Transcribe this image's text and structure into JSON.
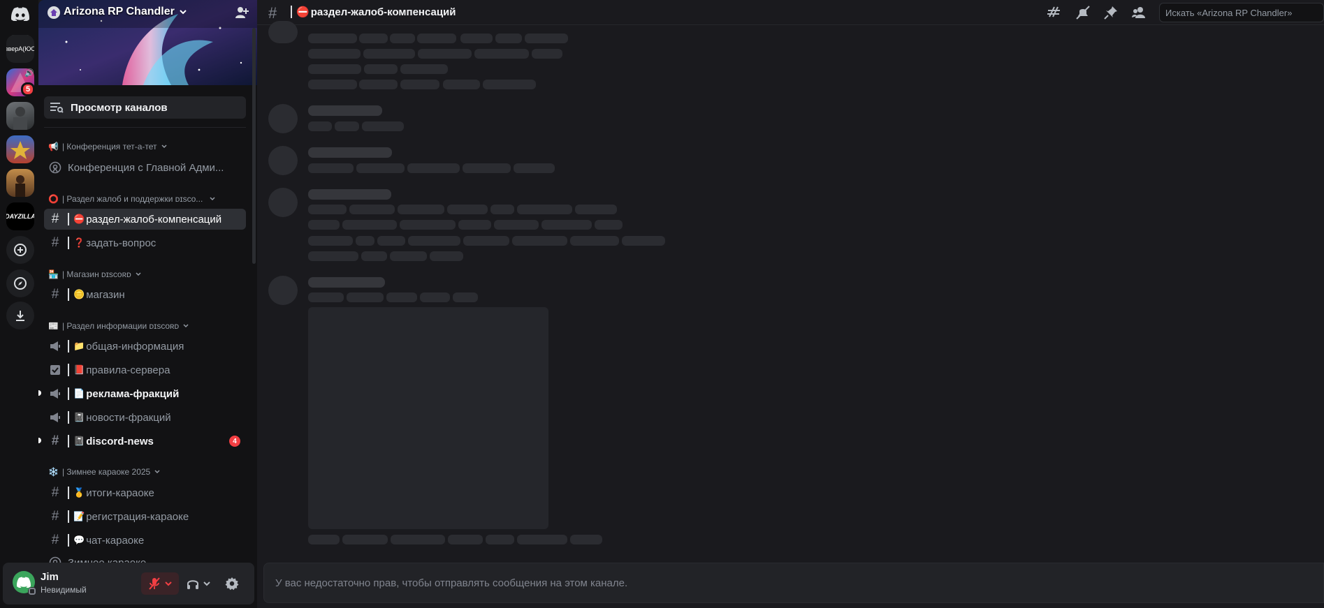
{
  "rail": {
    "server_labels": [
      "вверA(ЮО"
    ],
    "badges": [
      "5"
    ]
  },
  "server": {
    "name": "Arizona RP Chandler"
  },
  "sidebar": {
    "browse_label": "Просмотр каналов",
    "categories": [
      {
        "emoji": "📢",
        "label": "| Конференция тет-а-тет"
      },
      {
        "emoji": "⭕",
        "label": "| Раздел жалоб и поддержки ᴅɪsᴄᴏ..."
      },
      {
        "emoji": "🏪",
        "label": "| Магазин ᴅɪsᴄᴏʀᴅ"
      },
      {
        "emoji": "📰",
        "label": "| Раздел информации ᴅɪsᴄᴏʀᴅ"
      },
      {
        "emoji": "❄️",
        "label": "| Зимнее караоке 2025"
      }
    ],
    "channels": [
      {
        "label": "Конференция с Главной Адми...",
        "emoji": ""
      },
      {
        "label": "раздел-жалоб-компенсаций",
        "emoji": "⛔"
      },
      {
        "label": "задать-вопрос",
        "emoji": "❓"
      },
      {
        "label": "магазин",
        "emoji": "🪙"
      },
      {
        "label": "общая-информация",
        "emoji": "📁"
      },
      {
        "label": "правила-сервера",
        "emoji": "📕"
      },
      {
        "label": "реклама-фракций",
        "emoji": "📄"
      },
      {
        "label": "новости-фракций",
        "emoji": "📓"
      },
      {
        "label": "discord-news",
        "emoji": "📓",
        "badge": "4"
      },
      {
        "label": "итоги-караоке",
        "emoji": "🥇"
      },
      {
        "label": "регистрация-караоке",
        "emoji": "📝"
      },
      {
        "label": "чат-караоке",
        "emoji": "💬"
      },
      {
        "label": "Зимнее караоке",
        "emoji": ""
      }
    ]
  },
  "user": {
    "name": "Jim",
    "status": "Невидимый"
  },
  "header": {
    "channel_emoji": "⛔",
    "channel_name": "раздел-жалоб-компенсаций",
    "search_placeholder": "Искать «Arizona RP Chandler»"
  },
  "composer": {
    "no_permission_text": "У вас недостаточно прав, чтобы отправлять сообщения на этом канале."
  },
  "colors": {
    "accent_red": "#f23f43",
    "online_green": "#3ba55c",
    "background": "#1a1a1e"
  }
}
